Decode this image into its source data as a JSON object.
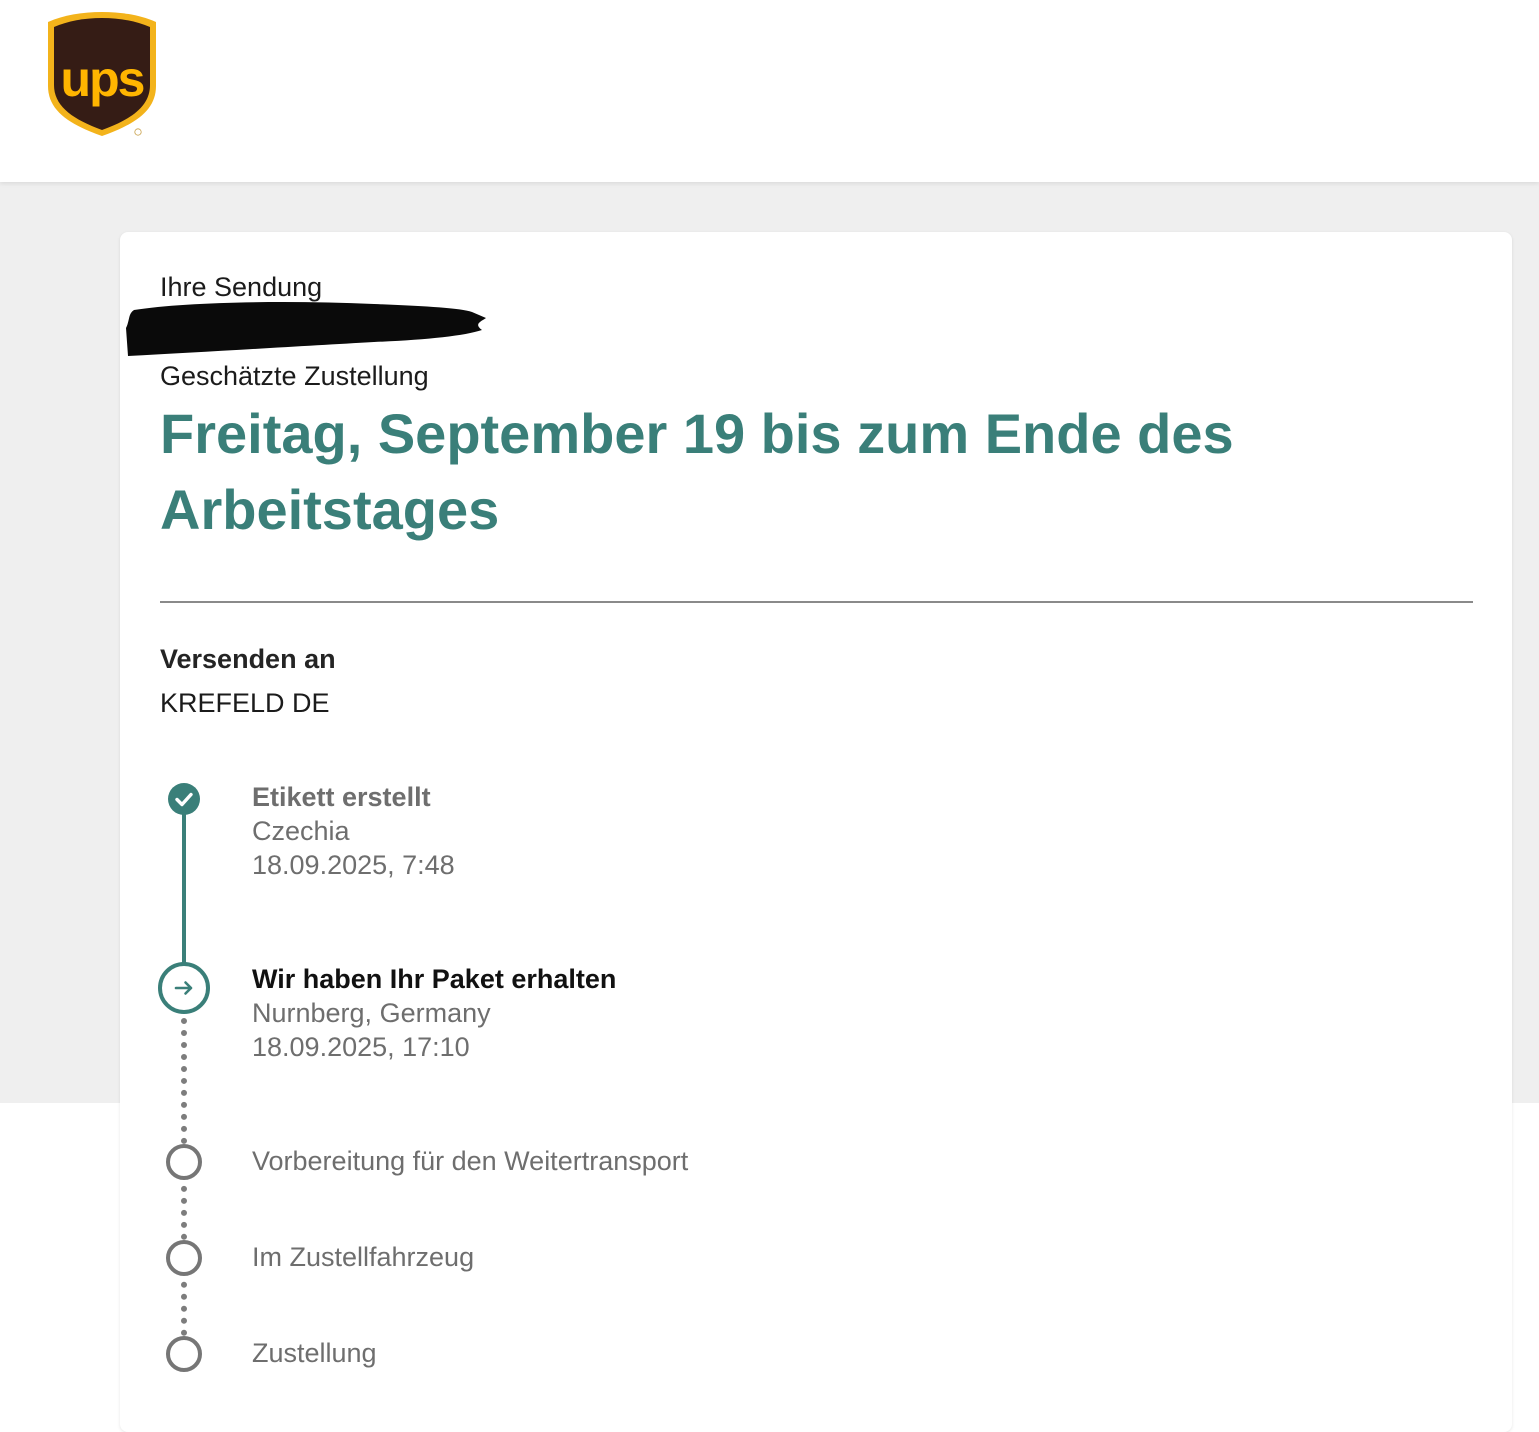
{
  "header": {
    "logo_text": "ups",
    "logo_icon": "ups-shield-logo",
    "brand_colors": {
      "shield": "#351c15",
      "gold": "#ffb500"
    }
  },
  "shipment": {
    "label": "Ihre Sendung",
    "tracking_number_redacted": true
  },
  "estimate": {
    "label": "Geschätzte Zustellung",
    "date_text": "Freitag, September 19 bis zum Ende des Arbeitstages"
  },
  "destination": {
    "label": "Versenden an",
    "value": "KREFELD DE"
  },
  "timeline": {
    "completed_color": "#3a7f79",
    "pending_color": "#767676",
    "events": [
      {
        "title": "Etikett erstellt",
        "location": "Czechia",
        "datetime": "18.09.2025, 7:48",
        "status": "completed",
        "icon": "check-circle-icon"
      },
      {
        "title": "Wir haben Ihr Paket erhalten",
        "location": "Nurnberg, Germany",
        "datetime": "18.09.2025, 17:10",
        "status": "current",
        "icon": "arrow-right-circle-icon"
      },
      {
        "title": "Vorbereitung für den Weitertransport",
        "status": "pending",
        "icon": "empty-circle-icon"
      },
      {
        "title": "Im Zustellfahrzeug",
        "status": "pending",
        "icon": "empty-circle-icon"
      },
      {
        "title": "Zustellung",
        "status": "pending",
        "icon": "empty-circle-icon"
      }
    ]
  }
}
